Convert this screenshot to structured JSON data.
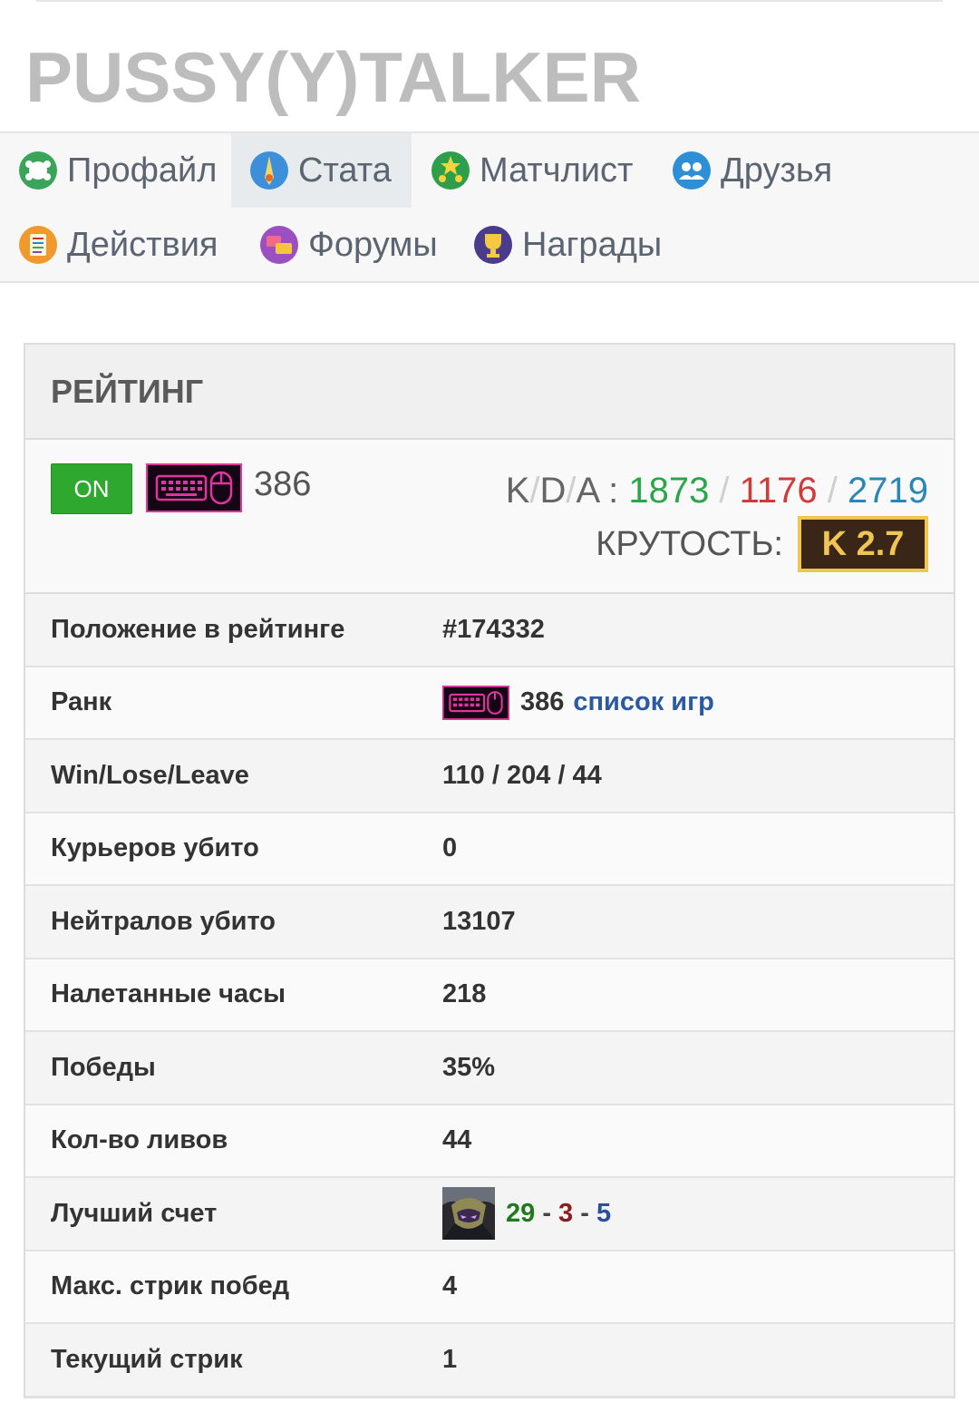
{
  "header": {
    "title": "PUSSY(Y)TALKER"
  },
  "nav": {
    "items": [
      {
        "label": "Профайл",
        "icon": "profile-icon"
      },
      {
        "label": "Стата",
        "icon": "stats-icon",
        "active": true
      },
      {
        "label": "Матчлист",
        "icon": "matchlist-icon"
      },
      {
        "label": "Друзья",
        "icon": "friends-icon"
      },
      {
        "label": "Действия",
        "icon": "actions-icon"
      },
      {
        "label": "Форумы",
        "icon": "forums-icon"
      },
      {
        "label": "Награды",
        "icon": "awards-icon"
      }
    ]
  },
  "rating": {
    "heading": "РЕЙТИНГ",
    "status_button": "ON",
    "rank_value": "386",
    "kda_label": "K/D/A :",
    "kda_k": "1873",
    "kda_d": "1176",
    "kda_a": "2719",
    "coolness_label": "КРУТОСТЬ:",
    "coolness_value": "K 2.7"
  },
  "stats": {
    "position_label": "Положение в рейтинге",
    "position_value": "#174332",
    "rank_label": "Ранк",
    "rank_value": "386",
    "rank_link": "список игр",
    "wll_label": "Win/Lose/Leave",
    "wll_value": "110 / 204 / 44",
    "couriers_label": "Курьеров убито",
    "couriers_value": "0",
    "neutrals_label": "Нейтралов убито",
    "neutrals_value": "13107",
    "hours_label": "Налетанные часы",
    "hours_value": "218",
    "wins_label": "Победы",
    "wins_value": "35%",
    "leaves_label": "Кол-во ливов",
    "leaves_value": "44",
    "best_label": "Лучший счет",
    "best_k": "29",
    "best_d": "3",
    "best_a": "5",
    "maxstreak_label": "Макс. стрик побед",
    "maxstreak_value": "4",
    "curstreak_label": "Текущий стрик",
    "curstreak_value": "1"
  },
  "colors": {
    "accent_link": "#2c5aa0",
    "on_green": "#2fa82f",
    "badge_gold": "#f2c450"
  }
}
